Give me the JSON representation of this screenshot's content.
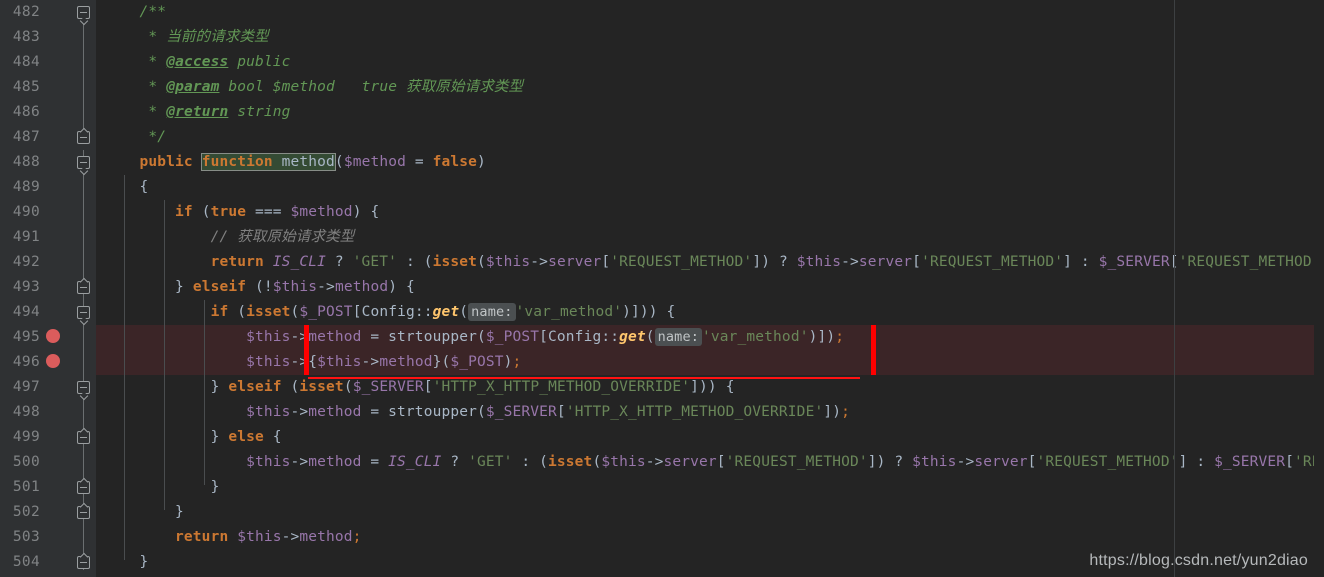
{
  "editor": {
    "theme_name": "darcula",
    "language": "PHP",
    "first_line_number": 482,
    "colors": {
      "background": "#242424",
      "gutter_background": "#2f3133",
      "line_number": "#808385",
      "highlight_band": "#3b2527",
      "error_marker": "#ff0000",
      "breakpoint": "#db5c5c",
      "keyword": "#cc7832",
      "string": "#6a8759",
      "variable": "#9876aa",
      "comment": "#629755",
      "function": "#ffc66d",
      "default_text": "#a9b7c6"
    },
    "gutter": {
      "breakpoints": [
        495,
        496
      ],
      "intention_bulb_line": 496,
      "fold_markers": [
        482,
        487,
        488,
        493,
        494,
        497,
        499,
        501,
        502,
        504
      ]
    },
    "inlay_hints": [
      {
        "line": 494,
        "label": "name:"
      },
      {
        "line": 495,
        "label": "name:"
      }
    ],
    "highlighted_lines": [
      495,
      496
    ]
  },
  "lines": [
    {
      "num": "482",
      "text": "    /**"
    },
    {
      "num": "483",
      "text": "     * 当前的请求类型"
    },
    {
      "num": "484",
      "text": "     * @access public"
    },
    {
      "num": "485",
      "text": "     * @param bool $method   true 获取原始请求类型"
    },
    {
      "num": "486",
      "text": "     * @return string"
    },
    {
      "num": "487",
      "text": "     */"
    },
    {
      "num": "488",
      "text": "    public function method($method = false)"
    },
    {
      "num": "489",
      "text": "    {"
    },
    {
      "num": "490",
      "text": "        if (true === $method) {"
    },
    {
      "num": "491",
      "text": "            // 获取原始请求类型"
    },
    {
      "num": "492",
      "text": "            return IS_CLI ? 'GET' : (isset($this->server['REQUEST_METHOD']) ? $this->server['REQUEST_METHOD'] : $_SERVER['REQUEST_METHOD']);"
    },
    {
      "num": "493",
      "text": "        } elseif (!$this->method) {"
    },
    {
      "num": "494",
      "text": "            if (isset($_POST[Config::get( name: 'var_method')])) {"
    },
    {
      "num": "495",
      "text": "                $this->method = strtoupper($_POST[Config::get( name: 'var_method')]);"
    },
    {
      "num": "496",
      "text": "                $this->{$this->method}($_POST);"
    },
    {
      "num": "497",
      "text": "            } elseif (isset($_SERVER['HTTP_X_HTTP_METHOD_OVERRIDE'])) {"
    },
    {
      "num": "498",
      "text": "                $this->method = strtoupper($_SERVER['HTTP_X_HTTP_METHOD_OVERRIDE']);"
    },
    {
      "num": "499",
      "text": "            } else {"
    },
    {
      "num": "500",
      "text": "                $this->method = IS_CLI ? 'GET' : (isset($this->server['REQUEST_METHOD']) ? $this->server['REQUEST_METHOD'] : $_SERVER['REQUEST_METHOD']);"
    },
    {
      "num": "501",
      "text": "            }"
    },
    {
      "num": "502",
      "text": "        }"
    },
    {
      "num": "503",
      "text": "        return $this->method;"
    },
    {
      "num": "504",
      "text": "    }"
    }
  ],
  "line_numbers": {
    "n482": "482",
    "n483": "483",
    "n484": "484",
    "n485": "485",
    "n486": "486",
    "n487": "487",
    "n488": "488",
    "n489": "489",
    "n490": "490",
    "n491": "491",
    "n492": "492",
    "n493": "493",
    "n494": "494",
    "n495": "495",
    "n496": "496",
    "n497": "497",
    "n498": "498",
    "n499": "499",
    "n500": "500",
    "n501": "501",
    "n502": "502",
    "n503": "503",
    "n504": "504"
  },
  "tokens": {
    "doc_open": "/**",
    "doc_star": "*",
    "doc_close": "*/",
    "doc_desc_cn": "当前的请求类型",
    "tag_access": "@access",
    "tag_access_val": "public",
    "tag_param": "@param",
    "tag_param_type": "bool",
    "tag_param_var": "$method",
    "tag_param_desc": "true 获取原始请求类型",
    "tag_return": "@return",
    "tag_return_type": "string",
    "kw_public": "public",
    "kw_function": "function",
    "name_method": "method",
    "param_method": "$method",
    "eq": " = ",
    "kw_false": "false",
    "brace_open": "{",
    "brace_close": "}",
    "kw_if": "if",
    "kw_true": "true",
    "op_identical": " === ",
    "comment_cn": "// 获取原始请求类型",
    "kw_return": "return",
    "const_is_cli": "IS_CLI",
    "str_get": "'GET'",
    "kw_isset": "isset",
    "var_this": "$this",
    "arrow": "->",
    "prop_server": "server",
    "str_request_method": "'REQUEST_METHOD'",
    "var_server_global": "$_SERVER",
    "kw_elseif": "elseif",
    "prop_method": "method",
    "var_post_global": "$_POST",
    "cls_config": "Config",
    "scope_res": "::",
    "meth_get": "get",
    "hint_name": "name:",
    "str_var_method": "'var_method'",
    "fn_strtoupper": "strtoupper",
    "str_http_override": "'HTTP_X_HTTP_METHOD_OVERRIDE'",
    "kw_else": "else",
    "semicolon": ";"
  },
  "watermark": {
    "url": "https://blog.csdn.net/yun2diao"
  }
}
